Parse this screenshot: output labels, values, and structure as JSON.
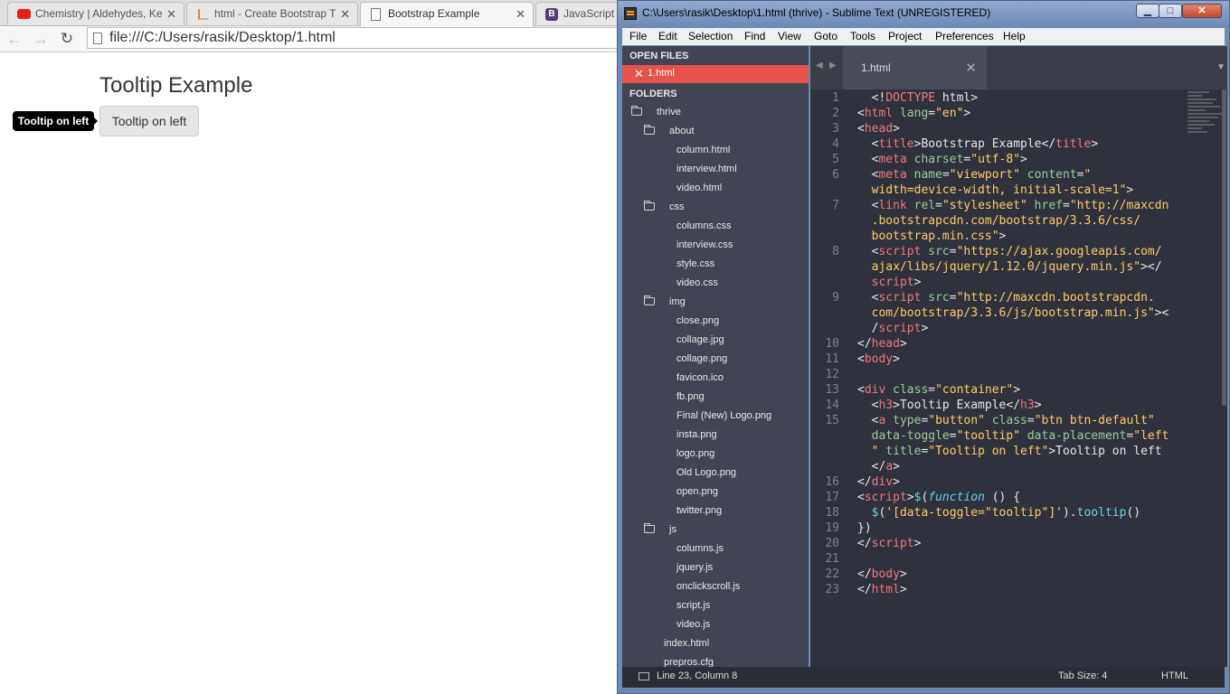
{
  "browser": {
    "tabs": [
      {
        "label": "Chemistry | Aldehydes, Ke",
        "icon": "youtube-icon"
      },
      {
        "label": "html - Create Bootstrap T",
        "icon": "stackoverflow-icon"
      },
      {
        "label": "Bootstrap Example",
        "icon": "page-icon"
      },
      {
        "label": "JavaScript",
        "icon": "bootstrap-icon"
      }
    ],
    "url": "file:///C:/Users/rasik/Desktop/1.html",
    "page": {
      "heading": "Tooltip Example",
      "button_label": "Tooltip on left",
      "tooltip_text": "Tooltip on left"
    }
  },
  "editor": {
    "window_title": "C:\\Users\\rasik\\Desktop\\1.html (thrive) - Sublime Text (UNREGISTERED)",
    "menu": [
      "File",
      "Edit",
      "Selection",
      "Find",
      "View",
      "Goto",
      "Tools",
      "Project",
      "Preferences",
      "Help"
    ],
    "sidebar": {
      "open_files_header": "OPEN FILES",
      "open_file": "1.html",
      "folders_header": "FOLDERS",
      "tree": [
        {
          "label": "thrive",
          "type": "folder",
          "depth": 0
        },
        {
          "label": "about",
          "type": "folder",
          "depth": 1
        },
        {
          "label": "column.html",
          "type": "file",
          "depth": 2
        },
        {
          "label": "interview.html",
          "type": "file",
          "depth": 2
        },
        {
          "label": "video.html",
          "type": "file",
          "depth": 2
        },
        {
          "label": "css",
          "type": "folder",
          "depth": 1
        },
        {
          "label": "columns.css",
          "type": "file",
          "depth": 2
        },
        {
          "label": "interview.css",
          "type": "file",
          "depth": 2
        },
        {
          "label": "style.css",
          "type": "file",
          "depth": 2
        },
        {
          "label": "video.css",
          "type": "file",
          "depth": 2
        },
        {
          "label": "img",
          "type": "folder",
          "depth": 1
        },
        {
          "label": "close.png",
          "type": "file",
          "depth": 2
        },
        {
          "label": "collage.jpg",
          "type": "file",
          "depth": 2
        },
        {
          "label": "collage.png",
          "type": "file",
          "depth": 2
        },
        {
          "label": "favicon.ico",
          "type": "file",
          "depth": 2
        },
        {
          "label": "fb.png",
          "type": "file",
          "depth": 2
        },
        {
          "label": "Final (New) Logo.png",
          "type": "file",
          "depth": 2
        },
        {
          "label": "insta.png",
          "type": "file",
          "depth": 2
        },
        {
          "label": "logo.png",
          "type": "file",
          "depth": 2
        },
        {
          "label": "Old Logo.png",
          "type": "file",
          "depth": 2
        },
        {
          "label": "open.png",
          "type": "file",
          "depth": 2
        },
        {
          "label": "twitter.png",
          "type": "file",
          "depth": 2
        },
        {
          "label": "js",
          "type": "folder",
          "depth": 1
        },
        {
          "label": "columns.js",
          "type": "file",
          "depth": 2
        },
        {
          "label": "jquery.js",
          "type": "file",
          "depth": 2
        },
        {
          "label": "onclickscroll.js",
          "type": "file",
          "depth": 2
        },
        {
          "label": "script.js",
          "type": "file",
          "depth": 2
        },
        {
          "label": "video.js",
          "type": "file",
          "depth": 2
        },
        {
          "label": "index.html",
          "type": "file",
          "depth": 1
        },
        {
          "label": "prepros.cfg",
          "type": "file",
          "depth": 1
        }
      ]
    },
    "tab_label": "1.html",
    "code_lines": [
      {
        "num": "1",
        "tokens": [
          [
            "wh",
            "  <!"
          ],
          [
            "tg",
            "DOCTYPE"
          ],
          [
            "wh",
            " html>"
          ]
        ]
      },
      {
        "num": "2",
        "tokens": [
          [
            "wh",
            "<"
          ],
          [
            "tg",
            "html"
          ],
          [
            "at",
            " lang"
          ],
          [
            "wh",
            "="
          ],
          [
            "st",
            "\"en\""
          ],
          [
            "wh",
            ">"
          ]
        ]
      },
      {
        "num": "3",
        "tokens": [
          [
            "wh",
            "<"
          ],
          [
            "tg",
            "head"
          ],
          [
            "wh",
            ">"
          ]
        ]
      },
      {
        "num": "4",
        "tokens": [
          [
            "wh",
            "  <"
          ],
          [
            "tg",
            "title"
          ],
          [
            "wh",
            ">Bootstrap Example</"
          ],
          [
            "tg",
            "title"
          ],
          [
            "wh",
            ">"
          ]
        ]
      },
      {
        "num": "5",
        "tokens": [
          [
            "wh",
            "  <"
          ],
          [
            "tg",
            "meta"
          ],
          [
            "at",
            " charset"
          ],
          [
            "wh",
            "="
          ],
          [
            "st",
            "\"utf-8\""
          ],
          [
            "wh",
            ">"
          ]
        ]
      },
      {
        "num": "6",
        "tokens": [
          [
            "wh",
            "  <"
          ],
          [
            "tg",
            "meta"
          ],
          [
            "at",
            " name"
          ],
          [
            "wh",
            "="
          ],
          [
            "st",
            "\"viewport\""
          ],
          [
            "at",
            " content"
          ],
          [
            "wh",
            "="
          ],
          [
            "st",
            "\""
          ]
        ]
      },
      {
        "num": "",
        "tokens": [
          [
            "st",
            "  width=device-width, initial-scale=1\""
          ],
          [
            "wh",
            ">"
          ]
        ]
      },
      {
        "num": "7",
        "tokens": [
          [
            "wh",
            "  <"
          ],
          [
            "tg",
            "link"
          ],
          [
            "at",
            " rel"
          ],
          [
            "wh",
            "="
          ],
          [
            "st",
            "\"stylesheet\""
          ],
          [
            "at",
            " href"
          ],
          [
            "wh",
            "="
          ],
          [
            "st",
            "\"http://maxcdn"
          ]
        ]
      },
      {
        "num": "",
        "tokens": [
          [
            "st",
            "  .bootstrapcdn.com/bootstrap/3.3.6/css/"
          ]
        ]
      },
      {
        "num": "",
        "tokens": [
          [
            "st",
            "  bootstrap.min.css\""
          ],
          [
            "wh",
            ">"
          ]
        ]
      },
      {
        "num": "8",
        "tokens": [
          [
            "wh",
            "  <"
          ],
          [
            "tg",
            "script"
          ],
          [
            "at",
            " src"
          ],
          [
            "wh",
            "="
          ],
          [
            "st",
            "\"https://ajax.googleapis.com/"
          ]
        ]
      },
      {
        "num": "",
        "tokens": [
          [
            "st",
            "  ajax/libs/jquery/1.12.0/jquery.min.js\""
          ],
          [
            "wh",
            "></"
          ]
        ]
      },
      {
        "num": "",
        "tokens": [
          [
            "tg",
            "  script"
          ],
          [
            "wh",
            ">"
          ]
        ]
      },
      {
        "num": "9",
        "tokens": [
          [
            "wh",
            "  <"
          ],
          [
            "tg",
            "script"
          ],
          [
            "at",
            " src"
          ],
          [
            "wh",
            "="
          ],
          [
            "st",
            "\"http://maxcdn.bootstrapcdn."
          ]
        ]
      },
      {
        "num": "",
        "tokens": [
          [
            "st",
            "  com/bootstrap/3.3.6/js/bootstrap.min.js\""
          ],
          [
            "wh",
            "><"
          ]
        ]
      },
      {
        "num": "",
        "tokens": [
          [
            "wh",
            "  /"
          ],
          [
            "tg",
            "script"
          ],
          [
            "wh",
            ">"
          ]
        ]
      },
      {
        "num": "10",
        "tokens": [
          [
            "wh",
            "</"
          ],
          [
            "tg",
            "head"
          ],
          [
            "wh",
            ">"
          ]
        ]
      },
      {
        "num": "11",
        "tokens": [
          [
            "wh",
            "<"
          ],
          [
            "tg",
            "body"
          ],
          [
            "wh",
            ">"
          ]
        ]
      },
      {
        "num": "12",
        "tokens": []
      },
      {
        "num": "13",
        "tokens": [
          [
            "wh",
            "<"
          ],
          [
            "tg",
            "div"
          ],
          [
            "at",
            " class"
          ],
          [
            "wh",
            "="
          ],
          [
            "st",
            "\"container\""
          ],
          [
            "wh",
            ">"
          ]
        ]
      },
      {
        "num": "14",
        "tokens": [
          [
            "wh",
            "  <"
          ],
          [
            "tg",
            "h3"
          ],
          [
            "wh",
            ">Tooltip Example</"
          ],
          [
            "tg",
            "h3"
          ],
          [
            "wh",
            ">"
          ]
        ]
      },
      {
        "num": "15",
        "tokens": [
          [
            "wh",
            "  <"
          ],
          [
            "tg",
            "a"
          ],
          [
            "at",
            " type"
          ],
          [
            "wh",
            "="
          ],
          [
            "st",
            "\"button\""
          ],
          [
            "at",
            " class"
          ],
          [
            "wh",
            "="
          ],
          [
            "st",
            "\"btn btn-default\""
          ]
        ]
      },
      {
        "num": "",
        "tokens": [
          [
            "at",
            "  data-toggle"
          ],
          [
            "wh",
            "="
          ],
          [
            "st",
            "\"tooltip\""
          ],
          [
            "at",
            " data-placement"
          ],
          [
            "wh",
            "="
          ],
          [
            "st",
            "\"left"
          ]
        ]
      },
      {
        "num": "",
        "tokens": [
          [
            "st",
            "  \""
          ],
          [
            "at",
            " title"
          ],
          [
            "wh",
            "="
          ],
          [
            "st",
            "\"Tooltip on left\""
          ],
          [
            "wh",
            ">Tooltip on left"
          ]
        ]
      },
      {
        "num": "",
        "tokens": [
          [
            "wh",
            "  </"
          ],
          [
            "tg",
            "a"
          ],
          [
            "wh",
            ">"
          ]
        ]
      },
      {
        "num": "16",
        "tokens": [
          [
            "wh",
            "</"
          ],
          [
            "tg",
            "div"
          ],
          [
            "wh",
            ">"
          ]
        ]
      },
      {
        "num": "17",
        "tokens": [
          [
            "wh",
            "<"
          ],
          [
            "tg",
            "script"
          ],
          [
            "wh",
            ">"
          ],
          [
            "fn",
            "$"
          ],
          [
            "wh",
            "("
          ],
          [
            "kw",
            "function"
          ],
          [
            "wh",
            " () {"
          ]
        ]
      },
      {
        "num": "18",
        "tokens": [
          [
            "wh",
            "  "
          ],
          [
            "fn",
            "$"
          ],
          [
            "wh",
            "("
          ],
          [
            "st",
            "'[data-toggle=\"tooltip\"]'"
          ],
          [
            "wh",
            ")."
          ],
          [
            "fn",
            "tooltip"
          ],
          [
            "wh",
            "()"
          ]
        ]
      },
      {
        "num": "19",
        "tokens": [
          [
            "wh",
            "})"
          ]
        ]
      },
      {
        "num": "20",
        "tokens": [
          [
            "wh",
            "</"
          ],
          [
            "tg",
            "script"
          ],
          [
            "wh",
            ">"
          ]
        ]
      },
      {
        "num": "21",
        "tokens": []
      },
      {
        "num": "22",
        "tokens": [
          [
            "wh",
            "</"
          ],
          [
            "tg",
            "body"
          ],
          [
            "wh",
            ">"
          ]
        ]
      },
      {
        "num": "23",
        "tokens": [
          [
            "wh",
            "</"
          ],
          [
            "tg",
            "html"
          ],
          [
            "wh",
            ">"
          ]
        ]
      }
    ],
    "status": {
      "position": "Line 23, Column 8",
      "tab_size": "Tab Size: 4",
      "syntax": "HTML"
    }
  }
}
